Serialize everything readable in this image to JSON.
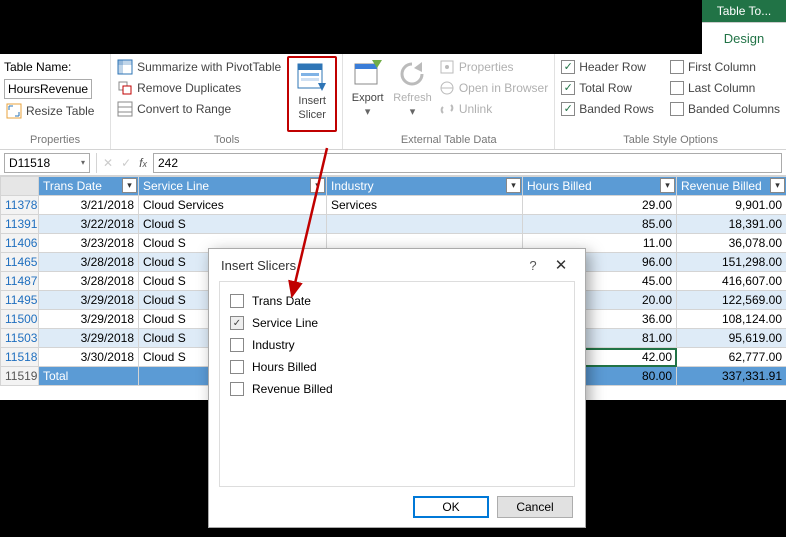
{
  "tab": {
    "group": "Table To...",
    "name": "Design"
  },
  "ribbon": {
    "properties": {
      "table_name_label": "Table Name:",
      "table_name_value": "HoursRevenue",
      "resize": "Resize Table",
      "group": "Properties"
    },
    "tools": {
      "pivot": "Summarize with PivotTable",
      "dupes": "Remove Duplicates",
      "range": "Convert to Range",
      "slicer_top": "Insert",
      "slicer_bot": "Slicer",
      "group": "Tools"
    },
    "ext": {
      "export": "Export",
      "refresh": "Refresh",
      "props": "Properties",
      "browser": "Open in Browser",
      "unlink": "Unlink",
      "group": "External Table Data"
    },
    "style_opts": {
      "header": "Header Row",
      "total": "Total Row",
      "banded_rows": "Banded Rows",
      "first": "First Column",
      "last": "Last Column",
      "banded_cols": "Banded Columns",
      "group": "Table Style Options"
    }
  },
  "formula": {
    "cell": "D11518",
    "value": "242"
  },
  "columns": {
    "c0": "",
    "c1": "Trans Date",
    "c2": "Service Line",
    "c3": "Industry",
    "c4": "Hours Billed",
    "c5": "Revenue Billed"
  },
  "rows": [
    {
      "n": "11378",
      "date": "3/21/2018",
      "svc": "Cloud Services",
      "ind": "Services",
      "hrs": "29.00",
      "rev": "9,901.00",
      "band": false
    },
    {
      "n": "11391",
      "date": "3/22/2018",
      "svc": "Cloud S",
      "ind": "",
      "hrs": "85.00",
      "rev": "18,391.00",
      "band": true
    },
    {
      "n": "11406",
      "date": "3/23/2018",
      "svc": "Cloud S",
      "ind": "",
      "hrs": "11.00",
      "rev": "36,078.00",
      "band": false
    },
    {
      "n": "11465",
      "date": "3/28/2018",
      "svc": "Cloud S",
      "ind": "",
      "hrs": "96.00",
      "rev": "151,298.00",
      "band": true
    },
    {
      "n": "11487",
      "date": "3/28/2018",
      "svc": "Cloud S",
      "ind": "",
      "hrs": "45.00",
      "rev": "416,607.00",
      "band": false
    },
    {
      "n": "11495",
      "date": "3/29/2018",
      "svc": "Cloud S",
      "ind": "",
      "hrs": "20.00",
      "rev": "122,569.00",
      "band": true
    },
    {
      "n": "11500",
      "date": "3/29/2018",
      "svc": "Cloud S",
      "ind": "",
      "hrs": "36.00",
      "rev": "108,124.00",
      "band": false
    },
    {
      "n": "11503",
      "date": "3/29/2018",
      "svc": "Cloud S",
      "ind": "",
      "hrs": "81.00",
      "rev": "95,619.00",
      "band": true
    },
    {
      "n": "11518",
      "date": "3/30/2018",
      "svc": "Cloud S",
      "ind": "",
      "hrs": "42.00",
      "rev": "62,777.00",
      "band": false,
      "active": true
    }
  ],
  "total": {
    "n": "11519",
    "label": "Total",
    "hrs": "80.00",
    "rev": "337,331.91"
  },
  "dialog": {
    "title": "Insert Slicers",
    "fields": [
      {
        "label": "Trans Date",
        "checked": false
      },
      {
        "label": "Service Line",
        "checked": true
      },
      {
        "label": "Industry",
        "checked": false
      },
      {
        "label": "Hours Billed",
        "checked": false
      },
      {
        "label": "Revenue Billed",
        "checked": false
      }
    ],
    "ok": "OK",
    "cancel": "Cancel"
  }
}
